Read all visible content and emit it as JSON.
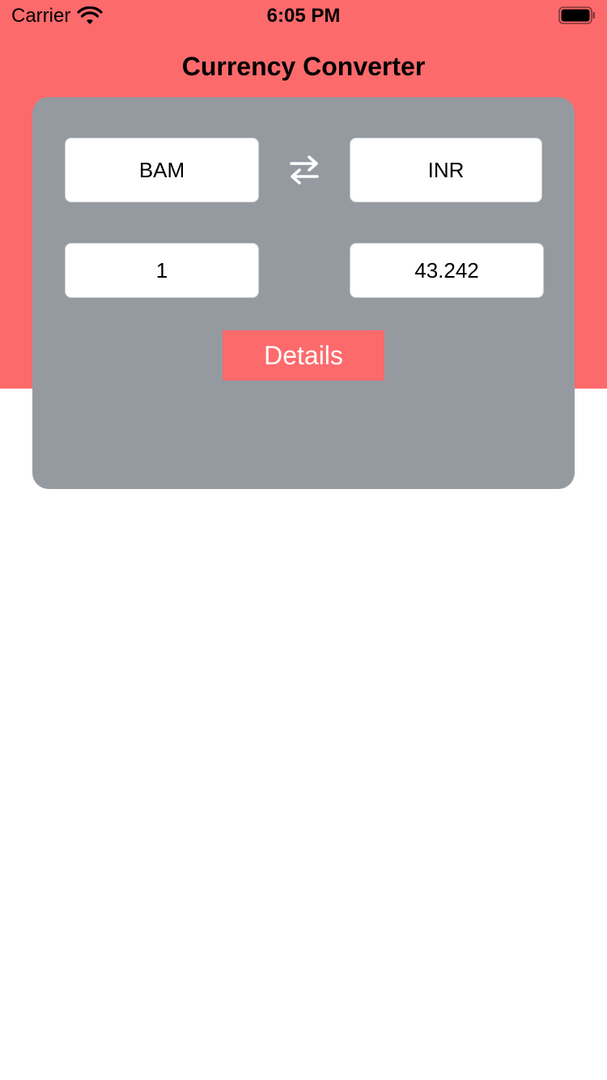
{
  "status_bar": {
    "carrier": "Carrier",
    "time": "6:05 PM",
    "wifi_icon": "wifi-icon",
    "battery_icon": "battery-icon"
  },
  "header": {
    "title": "Currency Converter",
    "background_color": "#fd6a6c"
  },
  "converter": {
    "card_color": "#959aa0",
    "from_currency": "BAM",
    "to_currency": "INR",
    "swap_icon": "swap-arrows-icon",
    "amount": "1",
    "result": "43.242",
    "details_label": "Details",
    "accent_color": "#fd6a6c"
  }
}
